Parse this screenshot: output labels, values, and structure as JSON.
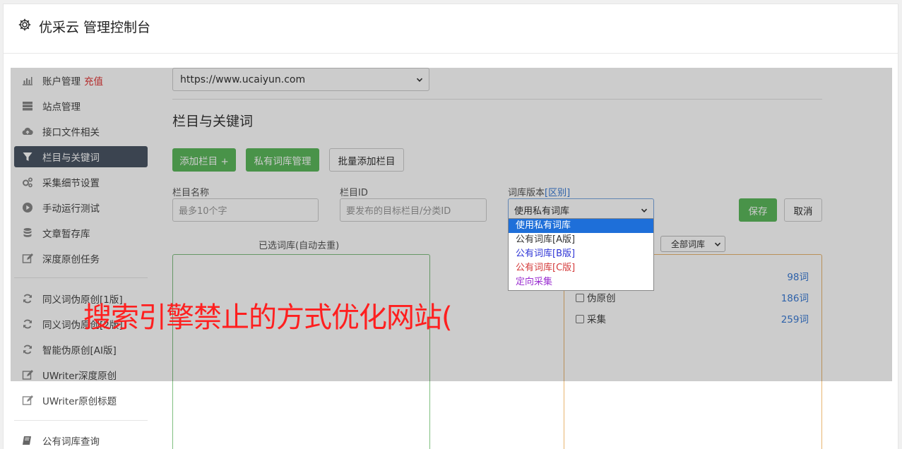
{
  "header": {
    "title": "优采云 管理控制台"
  },
  "sidebar": {
    "items": [
      {
        "label": "账户管理",
        "badge": "充值",
        "icon": "bar-chart-icon"
      },
      {
        "label": "站点管理",
        "icon": "server-icon"
      },
      {
        "label": "接口文件相关",
        "icon": "cloud-upload-icon"
      },
      {
        "label": "栏目与关键词",
        "icon": "filter-icon"
      },
      {
        "label": "采集细节设置",
        "icon": "gears-icon"
      },
      {
        "label": "手动运行测试",
        "icon": "play-icon"
      },
      {
        "label": "文章暂存库",
        "icon": "database-icon"
      },
      {
        "label": "深度原创任务",
        "icon": "edit-icon"
      },
      {
        "label": "同义词伪原创[1版]",
        "icon": "refresh-icon"
      },
      {
        "label": "同义词伪原创[2版]",
        "icon": "refresh-icon"
      },
      {
        "label": "智能伪原创[AI版]",
        "icon": "refresh-icon"
      },
      {
        "label": "UWriter深度原创",
        "icon": "edit-icon"
      },
      {
        "label": "UWriter原创标题",
        "icon": "edit-icon"
      },
      {
        "label": "公有词库查询",
        "icon": "book-icon"
      }
    ]
  },
  "main": {
    "site_select": "https://www.ucaiyun.com",
    "section_title": "栏目与关键词",
    "buttons": {
      "add_column": "添加栏目 +",
      "private_lib": "私有词库管理",
      "batch_add": "批量添加栏目",
      "save": "保存",
      "cancel": "取消"
    },
    "fields": {
      "name_label": "栏目名称",
      "name_placeholder": "最多10个字",
      "id_label": "栏目ID",
      "id_placeholder": "要发布的目标栏目/分类ID",
      "version_label": "词库版本",
      "version_link": "[区别]",
      "version_value": "使用私有词库"
    },
    "version_options": [
      {
        "label": "使用私有词库",
        "color": "#ffffff"
      },
      {
        "label": "公有词库[A版]",
        "color": "#333333"
      },
      {
        "label": "公有词库[B版]",
        "color": "#2f35d6"
      },
      {
        "label": "公有词库[C版]",
        "color": "#d43a3a"
      },
      {
        "label": "定向采集",
        "color": "#9b30d0"
      }
    ],
    "selected_lib_title": "已选词库(自动去重)",
    "lib_filter": "全部词库",
    "lib_list": [
      {
        "label": "",
        "count": "98词"
      },
      {
        "label": "伪原创",
        "count": "186词"
      },
      {
        "label": "采集",
        "count": "259词"
      }
    ]
  },
  "banner": "搜索引擎禁止的方式优化网站("
}
